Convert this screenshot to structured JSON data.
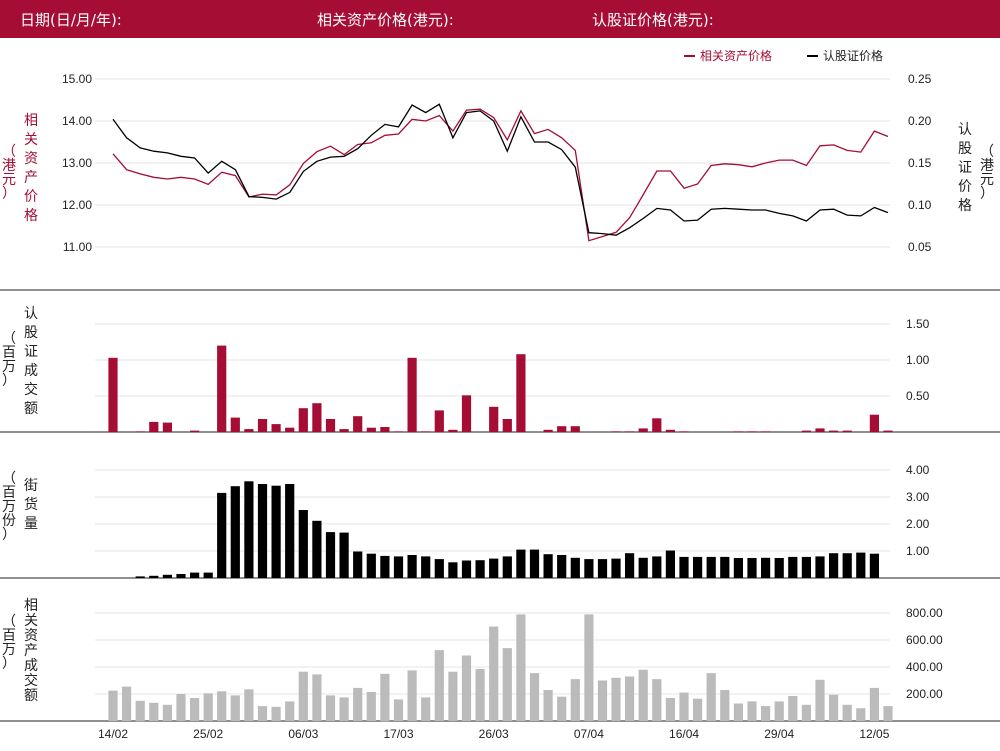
{
  "header": {
    "date_label": "日期(日/月/年):",
    "underlying_label": "相关资产价格(港元):",
    "warrant_label": "认股证价格(港元):"
  },
  "colors": {
    "header_bg": "#a50d35",
    "underlying": "#a50d35",
    "warrant": "#000000",
    "volume_bar": "#a50d35",
    "outstanding_bar": "#000000",
    "turnover_bar": "#bbbbbb"
  },
  "chart_data": [
    {
      "type": "line",
      "legend": [
        "相关资产价格",
        "认股证价格"
      ],
      "legend_position": "top-right",
      "ylabel_left": "相关资产价格",
      "ylabel_left_unit": "（港元）",
      "ylabel_right": "认股证价格",
      "ylabel_right_unit": "（港元）",
      "yticks_left": [
        "15.00",
        "14.00",
        "13.00",
        "12.00",
        "11.00"
      ],
      "yticks_right": [
        "0.25",
        "0.20",
        "0.15",
        "0.10",
        "0.05"
      ],
      "ylim_left": [
        10.0,
        15.0
      ],
      "ylim_right": [
        0.05,
        0.25
      ],
      "grid": true,
      "series": [
        {
          "name": "相关资产价格",
          "axis": "left",
          "values": [
            13.22,
            12.84,
            12.74,
            12.66,
            12.62,
            12.66,
            12.62,
            12.49,
            12.78,
            12.7,
            12.19,
            12.26,
            12.24,
            12.48,
            12.99,
            13.27,
            13.4,
            13.2,
            13.44,
            13.48,
            13.66,
            13.69,
            14.04,
            14.0,
            14.13,
            13.76,
            14.26,
            14.28,
            14.08,
            13.55,
            14.24,
            13.7,
            13.8,
            13.6,
            13.3,
            11.15,
            11.25,
            11.35,
            11.7,
            12.25,
            12.81,
            12.81,
            12.4,
            12.5,
            12.94,
            12.98,
            12.96,
            12.91,
            13.0,
            13.07,
            13.07,
            12.94,
            13.41,
            13.43,
            13.3,
            13.26,
            13.76,
            13.63
          ]
        },
        {
          "name": "认股证价格",
          "axis": "right",
          "values": [
            0.202,
            0.18,
            0.168,
            0.164,
            0.162,
            0.158,
            0.156,
            0.138,
            0.152,
            0.142,
            0.11,
            0.109,
            0.107,
            0.115,
            0.14,
            0.152,
            0.157,
            0.158,
            0.167,
            0.183,
            0.196,
            0.193,
            0.219,
            0.21,
            0.22,
            0.18,
            0.21,
            0.212,
            0.2,
            0.164,
            0.205,
            0.175,
            0.175,
            0.166,
            0.145,
            0.067,
            0.066,
            0.064,
            0.073,
            0.084,
            0.096,
            0.094,
            0.081,
            0.082,
            0.095,
            0.096,
            0.095,
            0.094,
            0.094,
            0.09,
            0.087,
            0.081,
            0.094,
            0.095,
            0.088,
            0.087,
            0.097,
            0.091
          ]
        }
      ]
    },
    {
      "type": "bar",
      "ylabel": "认股证成交额",
      "ylabel_unit": "（百万）",
      "yticks": [
        "1.50",
        "1.00",
        "0.50"
      ],
      "ylim": [
        0,
        1.5
      ],
      "values": [
        1.03,
        0,
        0.01,
        0.14,
        0.13,
        0,
        0.02,
        0,
        1.2,
        0.2,
        0.04,
        0.18,
        0.11,
        0.06,
        0.33,
        0.4,
        0.18,
        0.04,
        0.22,
        0.06,
        0.07,
        0.01,
        1.03,
        0.01,
        0.3,
        0.03,
        0.51,
        0,
        0.35,
        0.18,
        1.08,
        0,
        0.03,
        0.08,
        0.08,
        0,
        0,
        0.01,
        0.01,
        0.05,
        0.19,
        0.03,
        0.01,
        0,
        0,
        0,
        0.01,
        0.01,
        0.01,
        0,
        0,
        0.02,
        0.05,
        0.02,
        0.02,
        0,
        0.24,
        0.02
      ]
    },
    {
      "type": "bar",
      "ylabel": "街货量",
      "ylabel_unit": "（百万份）",
      "yticks": [
        "4.00",
        "3.00",
        "2.00",
        "1.00"
      ],
      "ylim": [
        0,
        4.0
      ],
      "values": [
        0,
        0,
        0.06,
        0.08,
        0.12,
        0.15,
        0.2,
        0.2,
        3.15,
        3.4,
        3.58,
        3.48,
        3.42,
        3.48,
        2.52,
        2.12,
        1.7,
        1.68,
        0.98,
        0.9,
        0.82,
        0.8,
        0.85,
        0.8,
        0.7,
        0.58,
        0.65,
        0.66,
        0.72,
        0.8,
        1.05,
        1.05,
        0.88,
        0.85,
        0.75,
        0.7,
        0.7,
        0.72,
        0.92,
        0.75,
        0.8,
        1.02,
        0.78,
        0.78,
        0.78,
        0.78,
        0.74,
        0.74,
        0.75,
        0.74,
        0.78,
        0.78,
        0.8,
        0.92,
        0.92,
        0.94,
        0.9
      ]
    },
    {
      "type": "bar",
      "ylabel": "相关资产成交额",
      "ylabel_unit": "（百万）",
      "yticks": [
        "800.00",
        "600.00",
        "400.00",
        "200.00"
      ],
      "ylim": [
        0,
        800
      ],
      "x_tick_labels": [
        "14/02",
        "25/02",
        "06/03",
        "17/03",
        "26/03",
        "07/04",
        "16/04",
        "29/04",
        "12/05"
      ],
      "values": [
        225,
        255,
        150,
        135,
        120,
        200,
        170,
        205,
        220,
        190,
        235,
        110,
        105,
        145,
        365,
        345,
        190,
        175,
        245,
        215,
        350,
        160,
        375,
        175,
        525,
        365,
        485,
        385,
        700,
        540,
        790,
        355,
        230,
        180,
        310,
        790,
        300,
        320,
        330,
        380,
        310,
        170,
        210,
        165,
        355,
        230,
        130,
        145,
        110,
        145,
        185,
        120,
        305,
        195,
        120,
        95,
        245,
        110
      ]
    }
  ]
}
